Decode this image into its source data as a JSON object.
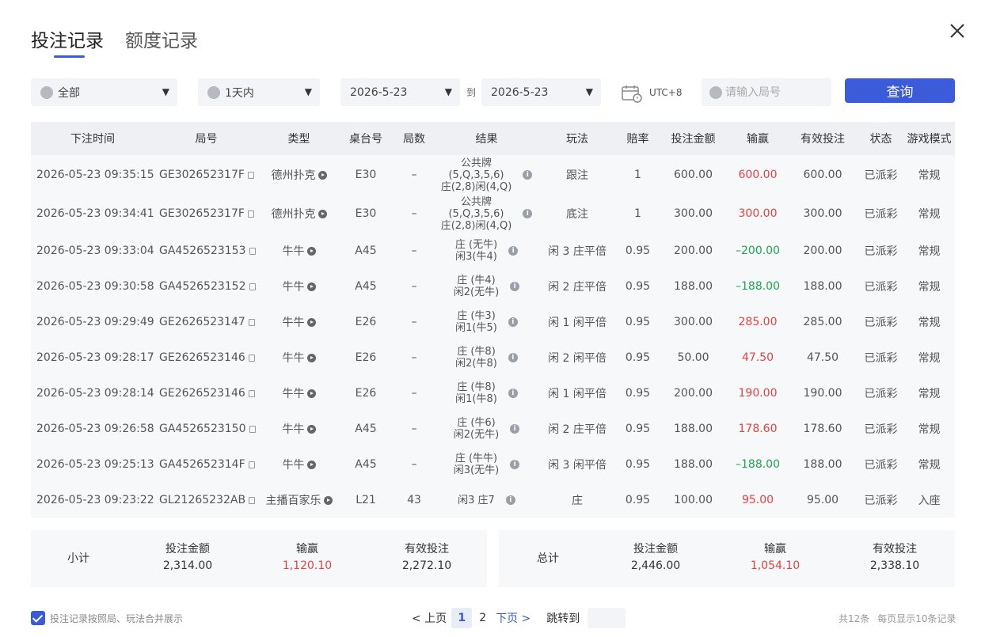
{
  "tabs": [
    {
      "label": "投注记录"
    },
    {
      "label": "额度记录"
    }
  ],
  "filters": {
    "game": "全部",
    "period": "1天内",
    "date_from": "2026-5-23",
    "to_label": "到",
    "date_to": "2026-5-23",
    "timezone": "UTC+8",
    "round_placeholder": "请输入局号",
    "query_label": "查询"
  },
  "table": {
    "headers": [
      "下注时间",
      "局号",
      "类型",
      "桌台号",
      "局数",
      "结果",
      "玩法",
      "赔率",
      "投注金额",
      "输赢",
      "有效投注",
      "状态",
      "游戏模式"
    ],
    "rows": [
      {
        "time": "2026-05-23 09:35:15",
        "round": "GE302652317F",
        "type": "德州扑克",
        "table": "E30",
        "count": "–",
        "result": [
          "公共牌",
          "(5,Q,3,5,6)",
          "庄(2,8)闲(4,Q)"
        ],
        "play": "跟注",
        "odds": "1",
        "bet": "600.00",
        "winloss": "600.00",
        "wl": "win",
        "valid": "600.00",
        "status": "已派彩",
        "mode": "常规"
      },
      {
        "time": "2026-05-23 09:34:41",
        "round": "GE302652317F",
        "type": "德州扑克",
        "table": "E30",
        "count": "–",
        "result": [
          "公共牌",
          "(5,Q,3,5,6)",
          "庄(2,8)闲(4,Q)"
        ],
        "play": "底注",
        "odds": "1",
        "bet": "300.00",
        "winloss": "300.00",
        "wl": "win",
        "valid": "300.00",
        "status": "已派彩",
        "mode": "常规"
      },
      {
        "time": "2026-05-23 09:33:04",
        "round": "GA4526523153",
        "type": "牛牛",
        "table": "A45",
        "count": "–",
        "result": [
          "庄 (无牛)",
          "闲3(牛4)"
        ],
        "play": "闲 3 庄平倍",
        "odds": "0.95",
        "bet": "200.00",
        "winloss": "–200.00",
        "wl": "lose",
        "valid": "200.00",
        "status": "已派彩",
        "mode": "常规"
      },
      {
        "time": "2026-05-23 09:30:58",
        "round": "GA4526523152",
        "type": "牛牛",
        "table": "A45",
        "count": "–",
        "result": [
          "庄 (牛4)",
          "闲2(无牛)"
        ],
        "play": "闲 2 庄平倍",
        "odds": "0.95",
        "bet": "188.00",
        "winloss": "–188.00",
        "wl": "lose",
        "valid": "188.00",
        "status": "已派彩",
        "mode": "常规"
      },
      {
        "time": "2026-05-23 09:29:49",
        "round": "GE2626523147",
        "type": "牛牛",
        "table": "E26",
        "count": "–",
        "result": [
          "庄 (牛3)",
          "闲1(牛5)"
        ],
        "play": "闲 1 闲平倍",
        "odds": "0.95",
        "bet": "300.00",
        "winloss": "285.00",
        "wl": "win",
        "valid": "285.00",
        "status": "已派彩",
        "mode": "常规"
      },
      {
        "time": "2026-05-23 09:28:17",
        "round": "GE2626523146",
        "type": "牛牛",
        "table": "E26",
        "count": "–",
        "result": [
          "庄 (牛8)",
          "闲2(牛8)"
        ],
        "play": "闲 2 闲平倍",
        "odds": "0.95",
        "bet": "50.00",
        "winloss": "47.50",
        "wl": "win",
        "valid": "47.50",
        "status": "已派彩",
        "mode": "常规"
      },
      {
        "time": "2026-05-23 09:28:14",
        "round": "GE2626523146",
        "type": "牛牛",
        "table": "E26",
        "count": "–",
        "result": [
          "庄 (牛8)",
          "闲1(牛8)"
        ],
        "play": "闲 1 闲平倍",
        "odds": "0.95",
        "bet": "200.00",
        "winloss": "190.00",
        "wl": "win",
        "valid": "190.00",
        "status": "已派彩",
        "mode": "常规"
      },
      {
        "time": "2026-05-23 09:26:58",
        "round": "GA4526523150",
        "type": "牛牛",
        "table": "A45",
        "count": "–",
        "result": [
          "庄 (牛6)",
          "闲2(无牛)"
        ],
        "play": "闲 2 庄平倍",
        "odds": "0.95",
        "bet": "188.00",
        "winloss": "178.60",
        "wl": "win",
        "valid": "178.60",
        "status": "已派彩",
        "mode": "常规"
      },
      {
        "time": "2026-05-23 09:25:13",
        "round": "GA452652314F",
        "type": "牛牛",
        "table": "A45",
        "count": "–",
        "result": [
          "庄 (牛牛)",
          "闲3(无牛)"
        ],
        "play": "闲 3 闲平倍",
        "odds": "0.95",
        "bet": "188.00",
        "winloss": "–188.00",
        "wl": "lose",
        "valid": "188.00",
        "status": "已派彩",
        "mode": "常规"
      },
      {
        "time": "2026-05-23 09:23:22",
        "round": "GL21265232AB",
        "type": "主播百家乐",
        "table": "L21",
        "count": "43",
        "result": [
          "闲3 庄7"
        ],
        "play": "庄",
        "odds": "0.95",
        "bet": "100.00",
        "winloss": "95.00",
        "wl": "win",
        "valid": "95.00",
        "status": "已派彩",
        "mode": "入座"
      }
    ]
  },
  "subtotal": {
    "label": "小计",
    "bet_label": "投注金额",
    "bet": "2,314.00",
    "wl_label": "输赢",
    "wl": "1,120.10",
    "valid_label": "有效投注",
    "valid": "2,272.10"
  },
  "grandtotal": {
    "label": "总计",
    "bet_label": "投注金额",
    "bet": "2,446.00",
    "wl_label": "输赢",
    "wl": "1,054.10",
    "valid_label": "有效投注",
    "valid": "2,338.10"
  },
  "footer": {
    "merge_label": "投注记录按照局、玩法合并展示",
    "prev": "< 上页",
    "page1": "1",
    "page2": "2",
    "next": "下页 >",
    "jump": "跳转到",
    "total": "共12条",
    "per_page": "每页显示10条记录"
  },
  "colors": {
    "accent": "#3b5bdb",
    "win": "#e8413f",
    "lose": "#1aa64a"
  }
}
